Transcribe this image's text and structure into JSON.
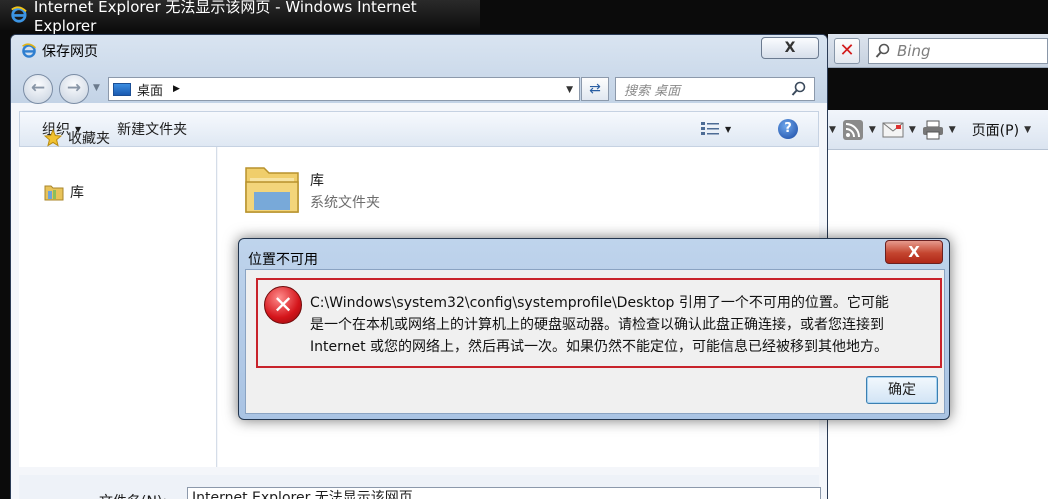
{
  "ie_window": {
    "title": "Internet Explorer 无法显示该网页 - Windows Internet Explorer",
    "search_placeholder": "Bing",
    "page_menu_label": "页面(P)"
  },
  "save_dialog": {
    "title": "保存网页",
    "close_label": "X",
    "address": {
      "location": "桌面",
      "separator": "▶"
    },
    "search_placeholder": "搜索 桌面",
    "toolbar": {
      "organize_label": "组织",
      "new_folder_label": "新建文件夹"
    },
    "nav_pane": {
      "items": [
        {
          "label": "收藏夹"
        },
        {
          "label": "库"
        }
      ]
    },
    "files": [
      {
        "name": "库",
        "type": "系统文件夹"
      }
    ],
    "filename": {
      "label": "文件名(N):",
      "value": "Internet Explorer 无法显示该网页"
    }
  },
  "error_dialog": {
    "title": "位置不可用",
    "close_label": "X",
    "message_lines": [
      "C:\\Windows\\system32\\config\\systemprofile\\Desktop 引用了一个不可用的位置。它可能",
      "是一个在本机或网络上的计算机上的硬盘驱动器。请检查以确认此盘正确连接，或者您连接到",
      "Internet 或您的网络上，然后再试一次。如果仍然不能定位，可能信息已经被移到其他地方。"
    ],
    "ok_label": "确定"
  },
  "colors": {
    "error_border": "#c8232b",
    "error_icon": "#d4141a",
    "close_button": "#c4452f",
    "ok_button_border": "#3c7fb1"
  }
}
